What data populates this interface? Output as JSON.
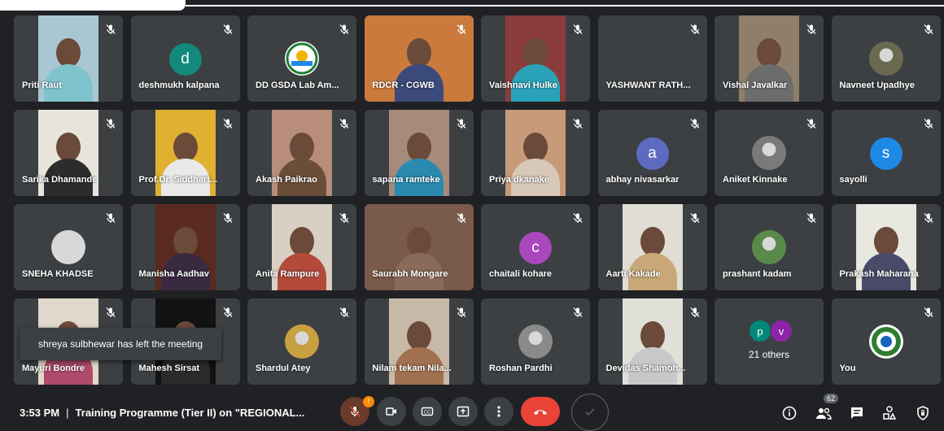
{
  "participants": [
    {
      "name": "Priti Raut",
      "type": "video",
      "tone": "#a9c7d3",
      "shirt": "#7fc4cc"
    },
    {
      "name": "deshmukh kalpana",
      "type": "letter",
      "letter": "d",
      "color": "#12897a"
    },
    {
      "name": "DD GSDA Lab Am...",
      "type": "logo",
      "color": "#1e7e34"
    },
    {
      "name": "RDCR - CGWB",
      "type": "video",
      "tone": "#c97a3c",
      "shirt": "#3a4a7a",
      "wide": true
    },
    {
      "name": "Vaishnavi Hulke",
      "type": "video",
      "tone": "#8a3b3b",
      "shirt": "#2aa3b8"
    },
    {
      "name": "YASHWANT RATH...",
      "type": "blank"
    },
    {
      "name": "Vishal Javalkar",
      "type": "video",
      "tone": "#8e7e6a",
      "shirt": "#6c6c6c"
    },
    {
      "name": "Navneet Upadhye",
      "type": "image",
      "color": "#6a6a50"
    },
    {
      "name": "Sarika Dhamande",
      "type": "video",
      "tone": "#e8e4dc",
      "shirt": "#2c2c2c"
    },
    {
      "name": "Prof.Dr. Siddhart...",
      "type": "video",
      "tone": "#e0b030",
      "shirt": "#e9e9e9"
    },
    {
      "name": "Akash Paikrao",
      "type": "video",
      "tone": "#b88d7a",
      "shirt": "#6a4e3a"
    },
    {
      "name": "sapana ramteke",
      "type": "video",
      "tone": "#a68a7a",
      "shirt": "#2a8ab0"
    },
    {
      "name": "Priya dkanake",
      "type": "video",
      "tone": "#c79a7a",
      "shirt": "#d8c8b8"
    },
    {
      "name": "abhay nivasarkar",
      "type": "letter",
      "letter": "a",
      "color": "#5c6bc0"
    },
    {
      "name": "Aniket Kinnake",
      "type": "image",
      "color": "#7a7a7a"
    },
    {
      "name": "sayolli",
      "type": "letter",
      "letter": "s",
      "color": "#1e88e5"
    },
    {
      "name": "SNEHA KHADSE",
      "type": "image",
      "color": "#d8d8d8"
    },
    {
      "name": "Manisha Aadhav",
      "type": "video",
      "tone": "#5a2a20",
      "shirt": "#3a2a40"
    },
    {
      "name": "Anita Rampure",
      "type": "video",
      "tone": "#d8d0c4",
      "shirt": "#b34a3a"
    },
    {
      "name": "Saurabh Mongare",
      "type": "video",
      "tone": "#7a5a4a",
      "shirt": "#8a6a5a",
      "wide": true
    },
    {
      "name": "chaitali kohare",
      "type": "letter",
      "letter": "c",
      "color": "#ab47bc"
    },
    {
      "name": "Aarti Kakade",
      "type": "video",
      "tone": "#e0ddd4",
      "shirt": "#c8a878"
    },
    {
      "name": "prashant kadam",
      "type": "image",
      "color": "#5a8a4a"
    },
    {
      "name": "Prakash Maharana",
      "type": "video",
      "tone": "#e8e8e0",
      "shirt": "#4a4a6a"
    },
    {
      "name": "Mayuri Bondre",
      "type": "video",
      "tone": "#e0d8cc",
      "shirt": "#b04a6a"
    },
    {
      "name": "Mahesh Sirsat",
      "type": "video",
      "tone": "#121212",
      "shirt": "#2a2a2a"
    },
    {
      "name": "Shardul Atey",
      "type": "image",
      "color": "#c8a040"
    },
    {
      "name": "Nilam tekam Nila...",
      "type": "video",
      "tone": "#c8b8a8",
      "shirt": "#a07050"
    },
    {
      "name": "Roshan Pardhi",
      "type": "image",
      "color": "#8a8a8a"
    },
    {
      "name": "Devidas Shamoh...",
      "type": "video",
      "tone": "#e0e0d8",
      "shirt": "#c8c8c8"
    },
    {
      "name": "21 others",
      "type": "others"
    },
    {
      "name": "You",
      "type": "logo2",
      "color": "#2e7d32"
    }
  ],
  "others_bubbles": [
    {
      "letter": "p",
      "color": "#00897b"
    },
    {
      "letter": "v",
      "color": "#8e24aa"
    }
  ],
  "toast": "shreya sulbhewar has left the meeting",
  "bottom": {
    "time": "3:53 PM",
    "separator": "|",
    "title": "Training Programme (Tier II) on \"REGIONAL...",
    "people_count": "62"
  }
}
